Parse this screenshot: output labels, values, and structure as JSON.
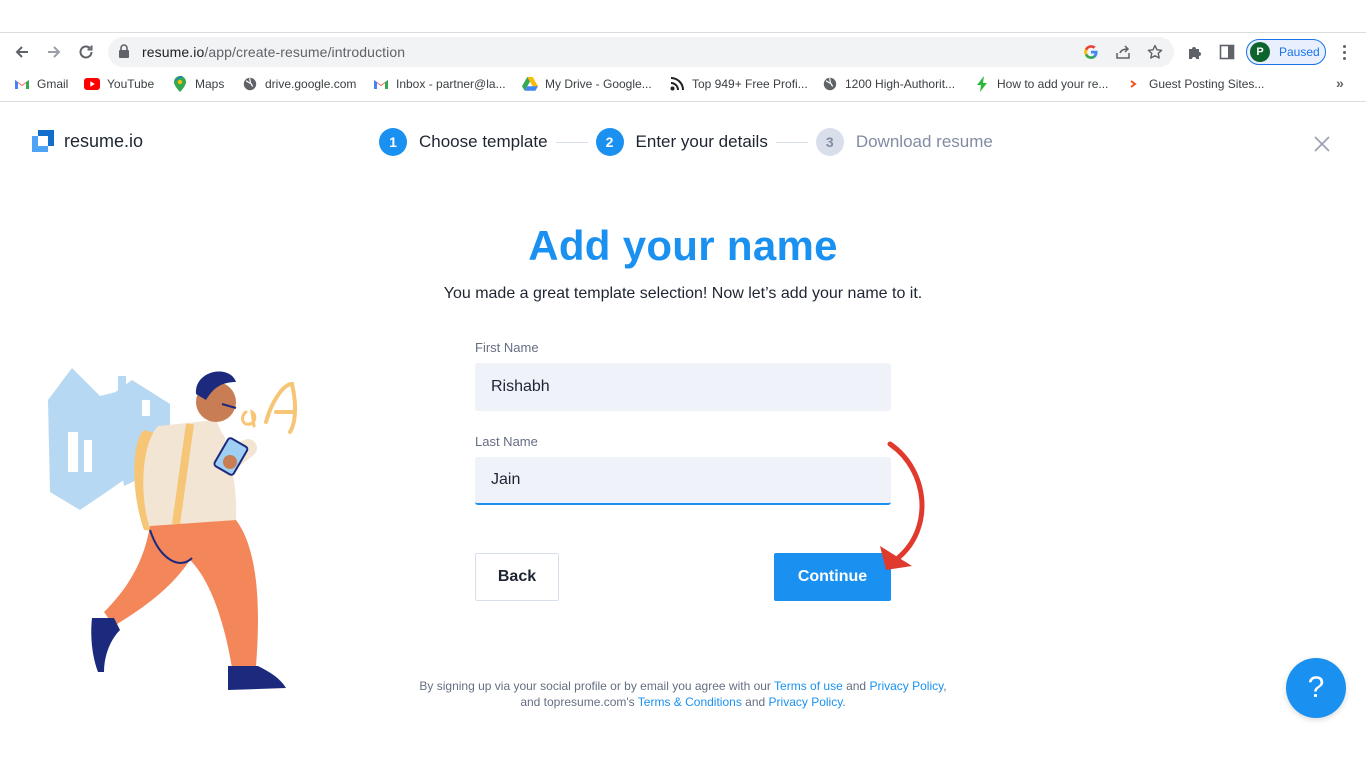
{
  "browser": {
    "url_host": "resume.io",
    "url_path": "/app/create-resume/introduction",
    "profile_initial": "P",
    "profile_status": "Paused",
    "bookmarks": [
      {
        "label": "Gmail",
        "icon": "gmail-icon"
      },
      {
        "label": "YouTube",
        "icon": "youtube-icon"
      },
      {
        "label": "Maps",
        "icon": "maps-icon"
      },
      {
        "label": "drive.google.com",
        "icon": "globe-icon"
      },
      {
        "label": "Inbox - partner@la...",
        "icon": "gmail-icon"
      },
      {
        "label": "My Drive - Google...",
        "icon": "drive-icon"
      },
      {
        "label": "Top 949+ Free Profi...",
        "icon": "rss-icon"
      },
      {
        "label": "1200 High-Authorit...",
        "icon": "globe-icon"
      },
      {
        "label": "How to add your re...",
        "icon": "bolt-icon"
      },
      {
        "label": "Guest Posting Sites...",
        "icon": "arrow-icon"
      }
    ],
    "more_bookmarks": "»"
  },
  "app": {
    "logo_text": "resume.io",
    "steps": [
      {
        "number": "1",
        "label": "Choose template",
        "state": "done"
      },
      {
        "number": "2",
        "label": "Enter your details",
        "state": "current"
      },
      {
        "number": "3",
        "label": "Download resume",
        "state": "upcoming"
      }
    ]
  },
  "form": {
    "title": "Add your name",
    "subtitle": "You made a great template selection! Now let’s add your name to it.",
    "first_name_label": "First Name",
    "first_name_value": "Rishabh",
    "last_name_label": "Last Name",
    "last_name_value": "Jain",
    "back_label": "Back",
    "continue_label": "Continue"
  },
  "legal": {
    "prefix": "By signing up via your social profile or by email you agree with our ",
    "terms_of_use": "Terms of use",
    "and1": " and ",
    "privacy_policy_1": "Privacy Policy",
    "middle": ", and topresume.com's ",
    "terms_conditions": "Terms & Conditions",
    "and2": " and ",
    "privacy_policy_2": "Privacy Policy",
    "suffix": "."
  },
  "help": {
    "label": "?"
  },
  "colors": {
    "accent": "#1a91f0",
    "arrow": "#e03a2f",
    "field_bg": "#eff2f9"
  }
}
